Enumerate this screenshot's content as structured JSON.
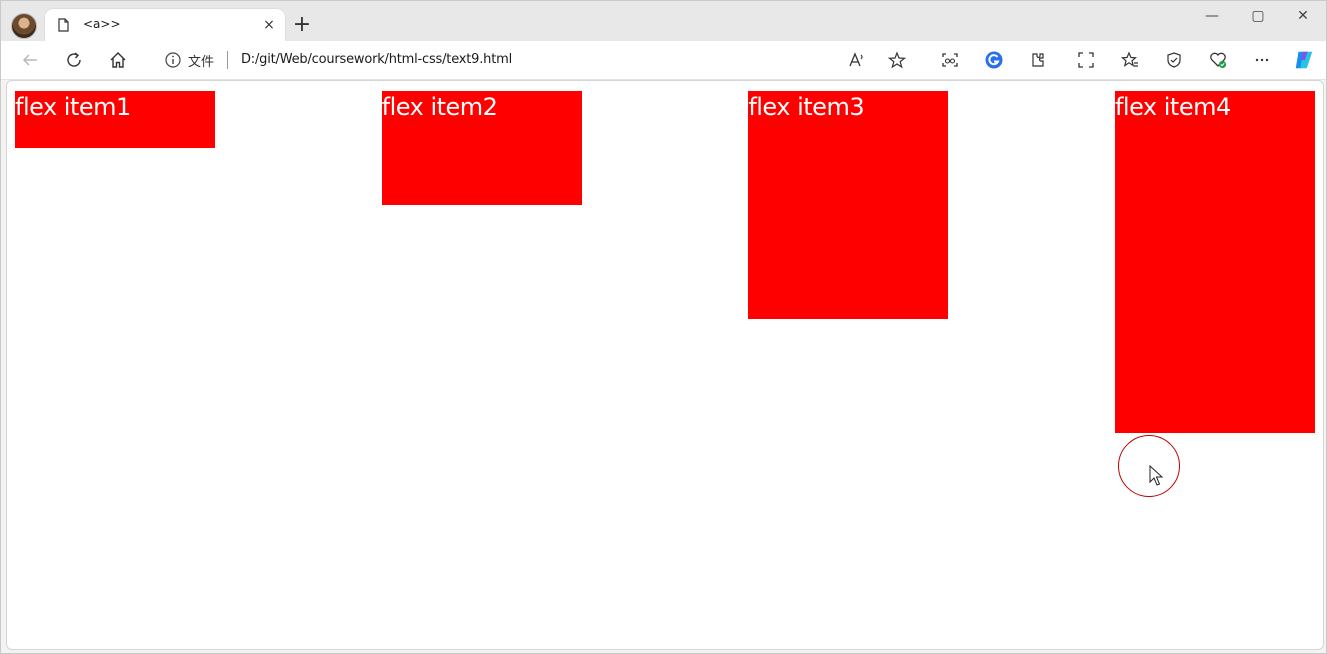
{
  "browser": {
    "tab": {
      "title": "<a>>",
      "close_glyph": "×"
    },
    "new_tab_glyph": "+",
    "window_controls": {
      "minimize": "—",
      "maximize": "▢",
      "close": "✕"
    },
    "address_bar": {
      "scheme_label": "文件",
      "url": "D:/git/Web/coursework/html-css/text9.html"
    },
    "icons": {
      "back": "arrow-left-icon",
      "refresh": "refresh-icon",
      "home": "home-icon",
      "info": "info-icon",
      "read_aloud": "read-aloud-icon",
      "favorite": "star-icon",
      "extensions": [
        "screenshot-icon",
        "extension-blue-icon",
        "extension-puzzle-icon",
        "fullscreen-icon",
        "favorites-icon",
        "browser-essentials-icon",
        "health-icon",
        "more-icon",
        "copilot-icon"
      ]
    },
    "accent_colors": {
      "copilot": "#1b8cf0",
      "extension_blue": "#2a6ee8",
      "health_badge": "#1e9c43"
    }
  },
  "page": {
    "items": [
      {
        "label": "flex item1"
      },
      {
        "label": "flex item2"
      },
      {
        "label": "flex item3"
      },
      {
        "label": "flex item4"
      }
    ],
    "item_color": "#ff0000",
    "item_text_color": "#ffffff"
  }
}
